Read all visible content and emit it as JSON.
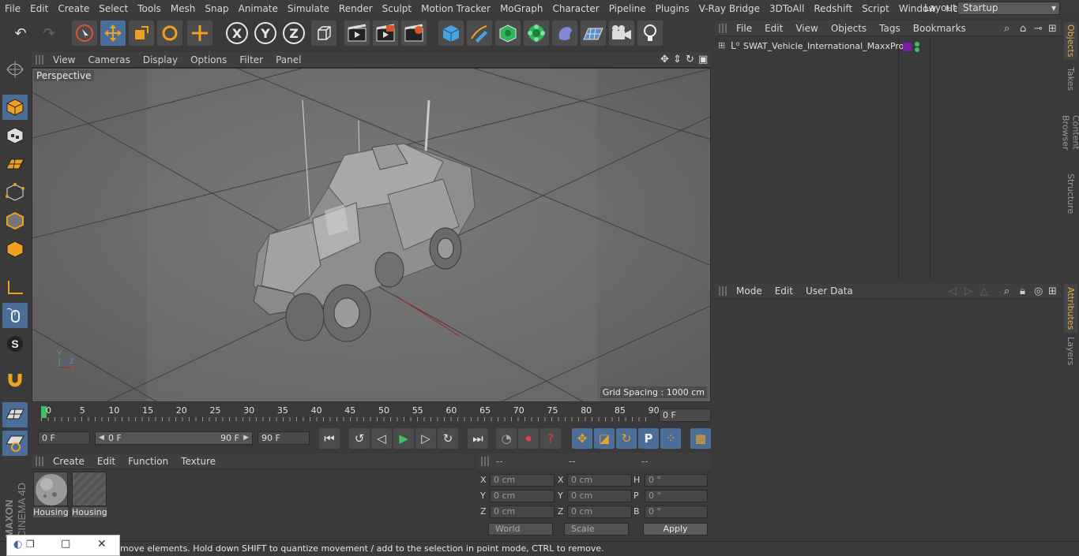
{
  "menubar": {
    "items": [
      "File",
      "Edit",
      "Create",
      "Select",
      "Tools",
      "Mesh",
      "Snap",
      "Animate",
      "Simulate",
      "Render",
      "Sculpt",
      "Motion Tracker",
      "MoGraph",
      "Character",
      "Pipeline",
      "Plugins",
      "V-Ray Bridge",
      "3DToAll",
      "Redshift",
      "Script",
      "Window",
      "Help"
    ],
    "layout_label": "Layout:",
    "layout_value": "Startup"
  },
  "viewport": {
    "menu": [
      "View",
      "Cameras",
      "Display",
      "Options",
      "Filter",
      "Panel"
    ],
    "camera_label": "Perspective",
    "grid_spacing": "Grid Spacing : 1000 cm"
  },
  "timeline": {
    "ticks": [
      "0",
      "5",
      "10",
      "15",
      "20",
      "25",
      "30",
      "35",
      "40",
      "45",
      "50",
      "55",
      "60",
      "65",
      "70",
      "75",
      "80",
      "85",
      "90"
    ],
    "current_frame": "0 F"
  },
  "playbar": {
    "start_field": "0 F",
    "range_start": "0 F",
    "range_end": "90 F",
    "end_field": "90 F"
  },
  "materials": {
    "menu": [
      "Create",
      "Edit",
      "Function",
      "Texture"
    ],
    "items": [
      {
        "label": "Housing"
      },
      {
        "label": "Housing"
      }
    ]
  },
  "coordinates": {
    "header": [
      "--",
      "--",
      "--"
    ],
    "rows": [
      {
        "a": "X",
        "av": "0 cm",
        "b": "X",
        "bv": "0 cm",
        "c": "H",
        "cv": "0 °"
      },
      {
        "a": "Y",
        "av": "0 cm",
        "b": "Y",
        "bv": "0 cm",
        "c": "P",
        "cv": "0 °"
      },
      {
        "a": "Z",
        "av": "0 cm",
        "b": "Z",
        "bv": "0 cm",
        "c": "B",
        "cv": "0 °"
      }
    ],
    "space": "World",
    "mode": "Scale",
    "apply": "Apply"
  },
  "objects": {
    "menu": [
      "File",
      "Edit",
      "View",
      "Objects",
      "Tags",
      "Bookmarks"
    ],
    "items": [
      {
        "name": "SWAT_Vehicle_International_MaxxPro",
        "layer_color": "#7a1fa0"
      }
    ]
  },
  "attributes": {
    "menu": [
      "Mode",
      "Edit",
      "User Data"
    ]
  },
  "right_tabs": [
    "Objects",
    "Takes",
    "Content Browser",
    "Structure",
    "Attributes",
    "Layers"
  ],
  "status": {
    "text": "move elements. Hold down SHIFT to quantize movement / add to the selection in point mode, CTRL to remove."
  },
  "brand": {
    "maker": "MAXON",
    "product": "CINEMA 4D"
  },
  "colors": {
    "accent": "#4a6e97",
    "active_tab": "#e6a84b"
  }
}
